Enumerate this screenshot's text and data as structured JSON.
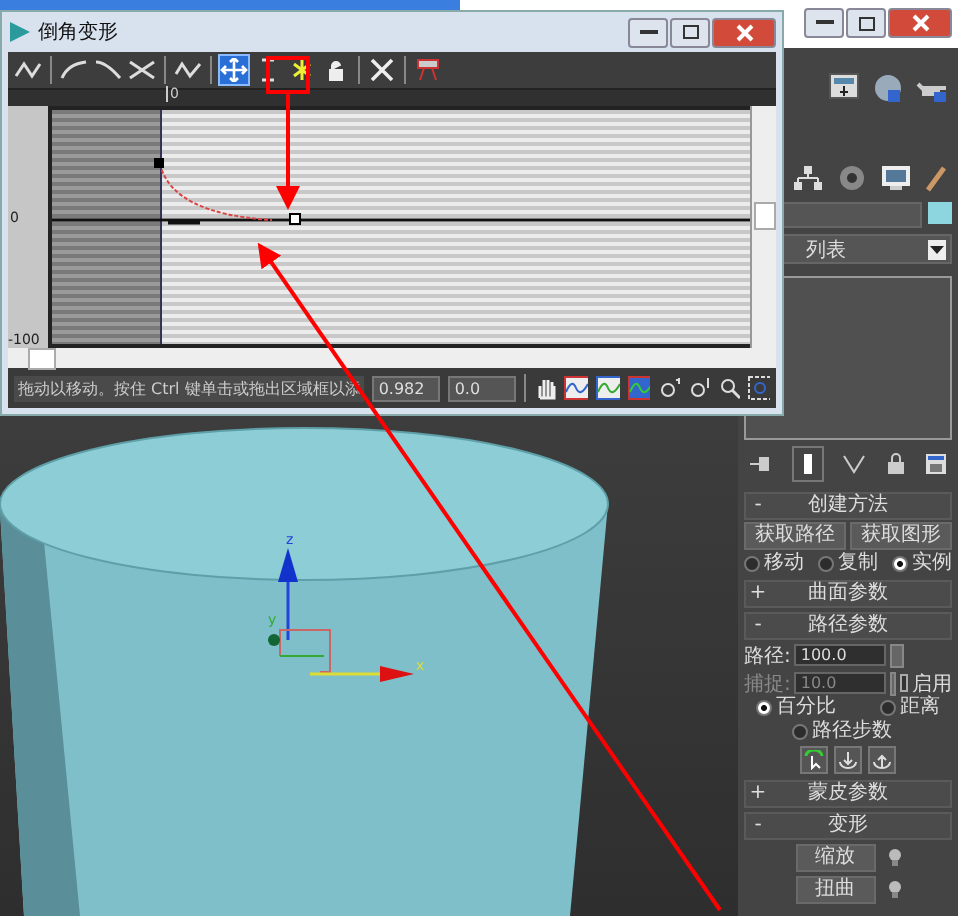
{
  "dialog": {
    "title": "倒角变形",
    "toolbar": [
      {
        "kind": "insert",
        "selected": false
      },
      {
        "kind": "line",
        "selected": false
      },
      {
        "kind": "curve",
        "selected": false
      },
      {
        "kind": "cross",
        "selected": false
      },
      {
        "kind": "wave",
        "selected": false
      },
      {
        "kind": "move",
        "selected": true
      },
      {
        "kind": "scale",
        "selected": false
      },
      {
        "kind": "point",
        "selected": false
      },
      {
        "kind": "lock",
        "selected": false
      },
      {
        "kind": "delete",
        "selected": false
      },
      {
        "kind": "reset",
        "selected": false
      }
    ],
    "ruler_label": "0",
    "y_labels": [
      "0",
      "-100"
    ],
    "status_text": "拖动以移动。按住 Ctrl 键单击或拖出区域框以添",
    "fields": [
      "0.982",
      "0.0"
    ]
  },
  "viewport": {
    "axis_labels": [
      "z",
      "y",
      "x"
    ]
  },
  "modifier_list": "列表",
  "creation_method": {
    "sign": "-",
    "title": "创建方法",
    "buttons": [
      "获取路径",
      "获取图形"
    ],
    "options": [
      {
        "label": "移动",
        "selected": false
      },
      {
        "label": "复制",
        "selected": false
      },
      {
        "label": "实例",
        "selected": true
      }
    ]
  },
  "surface_params": {
    "sign": "+",
    "title": "曲面参数"
  },
  "path_params": {
    "sign": "-",
    "title": "路径参数",
    "path": {
      "label": "路径:",
      "value": "100.0"
    },
    "snap": {
      "label": "捕捉:",
      "value": "10.0",
      "disabled": true
    },
    "enable": {
      "label": "启用",
      "checked": false
    },
    "modes": [
      {
        "label": "百分比",
        "selected": true
      },
      {
        "label": "距离",
        "selected": false
      },
      {
        "label": "路径步数",
        "selected": false
      }
    ]
  },
  "skin_params": {
    "sign": "+",
    "title": "蒙皮参数"
  },
  "deformations": {
    "sign": "-",
    "title": "变形",
    "items": [
      {
        "label": "缩放"
      },
      {
        "label": "扭曲"
      }
    ]
  }
}
